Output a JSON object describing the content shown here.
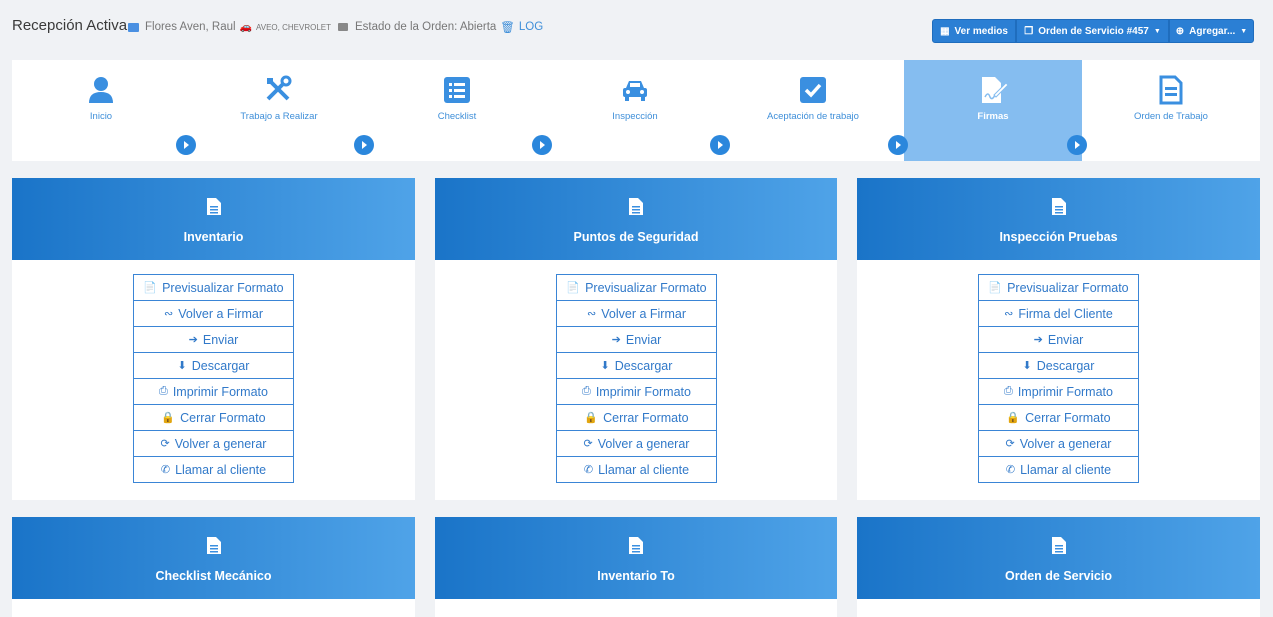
{
  "header": {
    "title": "Recepción Activa",
    "customer": "Flores Aven, Raul",
    "vehicle": "AVEO, CHEVROLET",
    "order_status": "Estado de la Orden: Abierta",
    "log_link": "LOG"
  },
  "toolbar": {
    "ver_medios": "Ver medios",
    "orden_servicio": "Orden de Servicio #457",
    "agregar": "Agregar..."
  },
  "steps": [
    {
      "label": "Inicio",
      "icon": "user-icon"
    },
    {
      "label": "Trabajo a Realizar",
      "icon": "tools-icon"
    },
    {
      "label": "Checklist",
      "icon": "list-icon"
    },
    {
      "label": "Inspección",
      "icon": "car-icon"
    },
    {
      "label": "Aceptación de trabajo",
      "icon": "checkbox-icon"
    },
    {
      "label": "Firmas",
      "icon": "signature-icon",
      "active": true
    },
    {
      "label": "Orden de Trabajo",
      "icon": "document-icon"
    }
  ],
  "cards": [
    {
      "title": "Inventario",
      "actions": [
        "Previsualizar Formato",
        "Volver a Firmar",
        "Enviar",
        "Descargar",
        "Imprimir Formato",
        "Cerrar Formato",
        "Volver a generar",
        "Llamar al cliente"
      ]
    },
    {
      "title": "Puntos de Seguridad",
      "actions": [
        "Previsualizar Formato",
        "Volver a Firmar",
        "Enviar",
        "Descargar",
        "Imprimir Formato",
        "Cerrar Formato",
        "Volver a generar",
        "Llamar al cliente"
      ]
    },
    {
      "title": "Inspección Pruebas",
      "actions": [
        "Previsualizar Formato",
        "Firma del Cliente",
        "Enviar",
        "Descargar",
        "Imprimir Formato",
        "Cerrar Formato",
        "Volver a generar",
        "Llamar al cliente"
      ]
    },
    {
      "title": "Checklist Mecánico"
    },
    {
      "title": "Inventario To"
    },
    {
      "title": "Orden de Servicio"
    }
  ],
  "colors": {
    "accent": "#2b7fd4",
    "active_step": "#85bdf0",
    "header_gradient_start": "#1a74c8",
    "header_gradient_end": "#4fa3e8"
  }
}
